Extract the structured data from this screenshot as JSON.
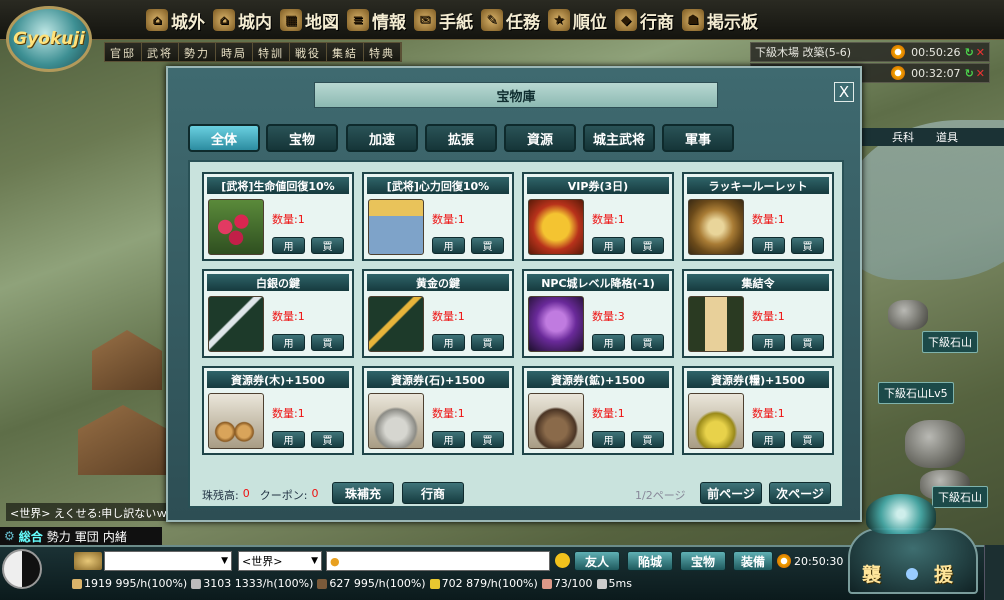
{
  "logo_text": "Gyokuji",
  "top_menu": [
    {
      "label": "城外",
      "icon": "castle-out-icon"
    },
    {
      "label": "城内",
      "icon": "castle-in-icon"
    },
    {
      "label": "地図",
      "icon": "map-icon"
    },
    {
      "label": "情報",
      "icon": "scroll-icon"
    },
    {
      "label": "手紙",
      "icon": "letter-icon"
    },
    {
      "label": "任務",
      "icon": "mission-icon"
    },
    {
      "label": "順位",
      "icon": "ranking-icon"
    },
    {
      "label": "行商",
      "icon": "merchant-icon"
    },
    {
      "label": "掲示板",
      "icon": "board-icon"
    }
  ],
  "sub_menu": [
    "官邸",
    "武将",
    "勢力",
    "時局",
    "特訓",
    "戦役",
    "集結",
    "特典"
  ],
  "timers": [
    {
      "label": "下級木場 改築(5-6)",
      "time": "00:50:26"
    },
    {
      "label": "",
      "time": "00:32:07"
    }
  ],
  "right_labels": [
    "兵科",
    "道具"
  ],
  "map_labels": [
    "下級石山",
    "下級石山Lv5",
    "下級石山"
  ],
  "modal": {
    "title": "宝物庫",
    "close": "X",
    "tabs": [
      "全体",
      "宝物",
      "加速",
      "拡張",
      "資源",
      "城主武将",
      "軍事"
    ],
    "active_tab": 0,
    "use_label": "用",
    "buy_label": "買",
    "items": [
      {
        "name": "[武将]生命値回復10%",
        "qty": "数量:1",
        "icon": "berries-icon"
      },
      {
        "name": "[武将]心力回復10%",
        "qty": "数量:1",
        "icon": "coin-jar-icon"
      },
      {
        "name": "VIP券(3日)",
        "qty": "数量:1",
        "icon": "vip-badge-icon"
      },
      {
        "name": "ラッキールーレット",
        "qty": "数量:1",
        "icon": "roulette-icon"
      },
      {
        "name": "白銀の鍵",
        "qty": "数量:1",
        "icon": "silver-key-icon"
      },
      {
        "name": "黄金の鍵",
        "qty": "数量:1",
        "icon": "gold-key-icon"
      },
      {
        "name": "NPC城レベル降格(-1)",
        "qty": "数量:3",
        "icon": "npc-castle-icon"
      },
      {
        "name": "集結令",
        "qty": "数量:1",
        "icon": "muster-order-icon"
      },
      {
        "name": "資源券(木)+1500",
        "qty": "数量:1",
        "icon": "wood-resource-icon"
      },
      {
        "name": "資源券(石)+1500",
        "qty": "数量:1",
        "icon": "stone-resource-icon"
      },
      {
        "name": "資源券(鉱)+1500",
        "qty": "数量:1",
        "icon": "ore-resource-icon"
      },
      {
        "name": "資源券(糧)+1500",
        "qty": "数量:1",
        "icon": "grain-resource-icon"
      }
    ],
    "footer": {
      "pearl_label": "珠残高:",
      "pearl_value": "0",
      "coupon_label": "クーポン:",
      "coupon_value": "0",
      "recharge_btn": "珠補充",
      "merchant_btn": "行商",
      "page": "1/2ページ",
      "prev_btn": "前ページ",
      "next_btn": "次ページ"
    }
  },
  "chat": {
    "line": "<世界> えくせる:申し訳ないｗｗ",
    "tabs": [
      "総合",
      "勢力",
      "軍団",
      "内緒"
    ]
  },
  "bottom": {
    "channel": "<世界>",
    "buttons": [
      "友人",
      "陥城",
      "宝物",
      "装備"
    ],
    "clock": "20:50:30",
    "resources": [
      "1919 995/h(100%)",
      "3103 1333/h(100%)",
      "627 995/h(100%)",
      "702 879/h(100%)",
      "73/100",
      "5ms"
    ],
    "raid_left": "襲",
    "raid_right": "援"
  }
}
